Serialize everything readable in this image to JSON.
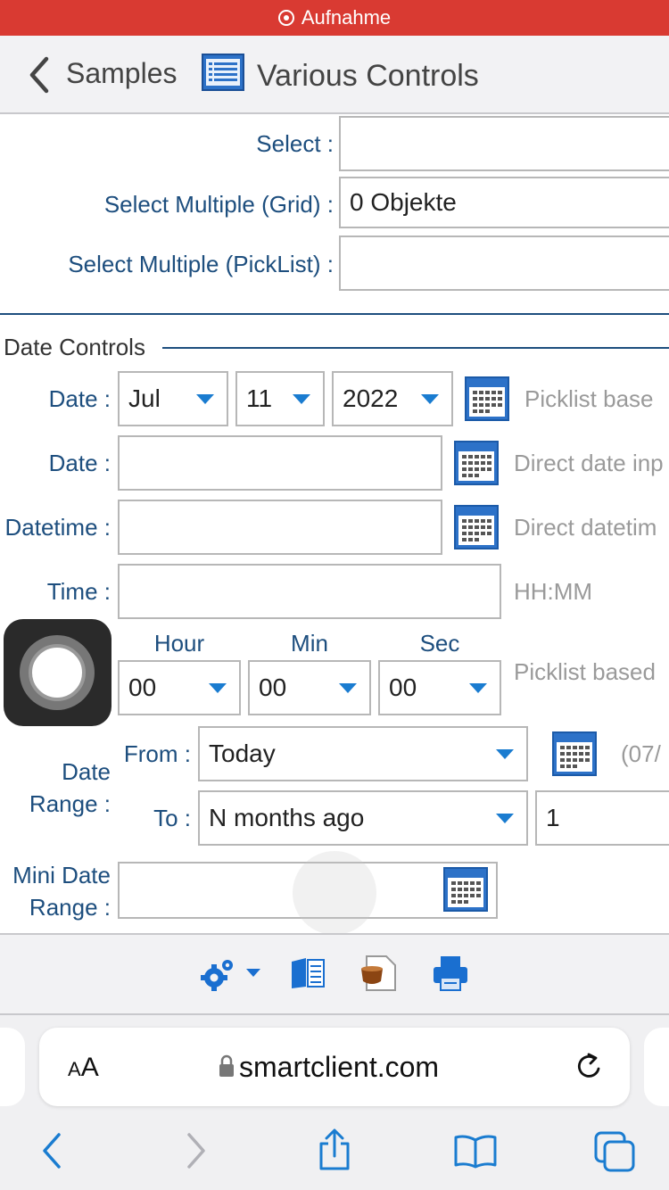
{
  "recording": {
    "label": "Aufnahme"
  },
  "header": {
    "back_label": "Samples",
    "title": "Various Controls"
  },
  "selects": {
    "select_label": "Select :",
    "select_value": "",
    "multi_grid_label": "Select Multiple (Grid) :",
    "multi_grid_value": "0 Objekte",
    "multi_picklist_label": "Select Multiple (PickList) :",
    "multi_picklist_value": ""
  },
  "date_section": {
    "title": "Date Controls"
  },
  "date_picklist": {
    "label": "Date :",
    "month": "Jul",
    "day": "11",
    "year": "2022",
    "hint": "Picklist base"
  },
  "date_direct": {
    "label": "Date :",
    "value": "",
    "hint": "Direct date inp"
  },
  "datetime": {
    "label": "Datetime :",
    "value": "",
    "hint": "Direct datetim"
  },
  "time": {
    "label": "Time :",
    "value": "",
    "hint": "HH:MM"
  },
  "time_picklist": {
    "hour_label": "Hour",
    "min_label": "Min",
    "sec_label": "Sec",
    "hour": "00",
    "min": "00",
    "sec": "00",
    "hint": "Picklist based"
  },
  "date_range": {
    "label_line1": "Date",
    "label_line2": "Range :",
    "from_label": "From :",
    "from_value": "Today",
    "from_hint": "(07/",
    "to_label": "To :",
    "to_value": "N months ago",
    "to_number": "1"
  },
  "mini_date_range": {
    "label_line1": "Mini Date",
    "label_line2": "Range :",
    "value": ""
  },
  "browser": {
    "aa_label": "AA",
    "url": "smartclient.com"
  },
  "colors": {
    "accent": "#1a7cd0",
    "recording": "#d93a32",
    "label": "#1d4e7e"
  }
}
